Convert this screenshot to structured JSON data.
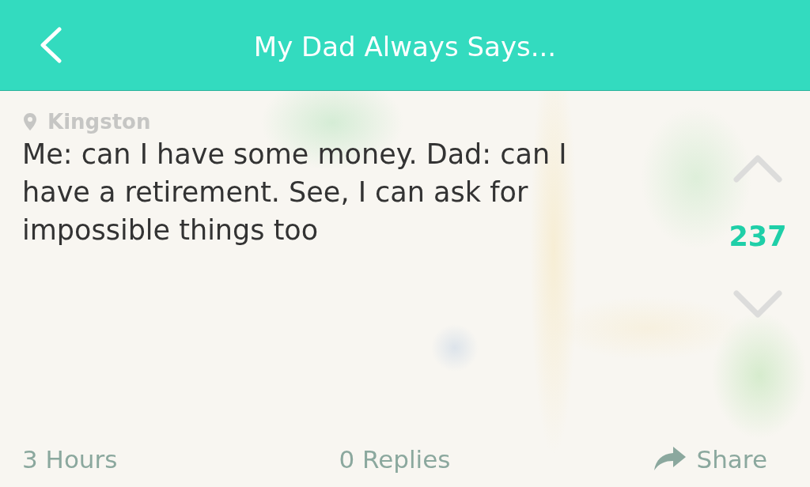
{
  "header": {
    "title": "My Dad Always Says..."
  },
  "post": {
    "location": "Kingston",
    "text": "Me: can I have some money. Dad: can I have a retirement. See, I can ask for impossible things too",
    "score": "237"
  },
  "footer": {
    "time": "3 Hours",
    "replies": "0 Replies",
    "share": "Share"
  }
}
